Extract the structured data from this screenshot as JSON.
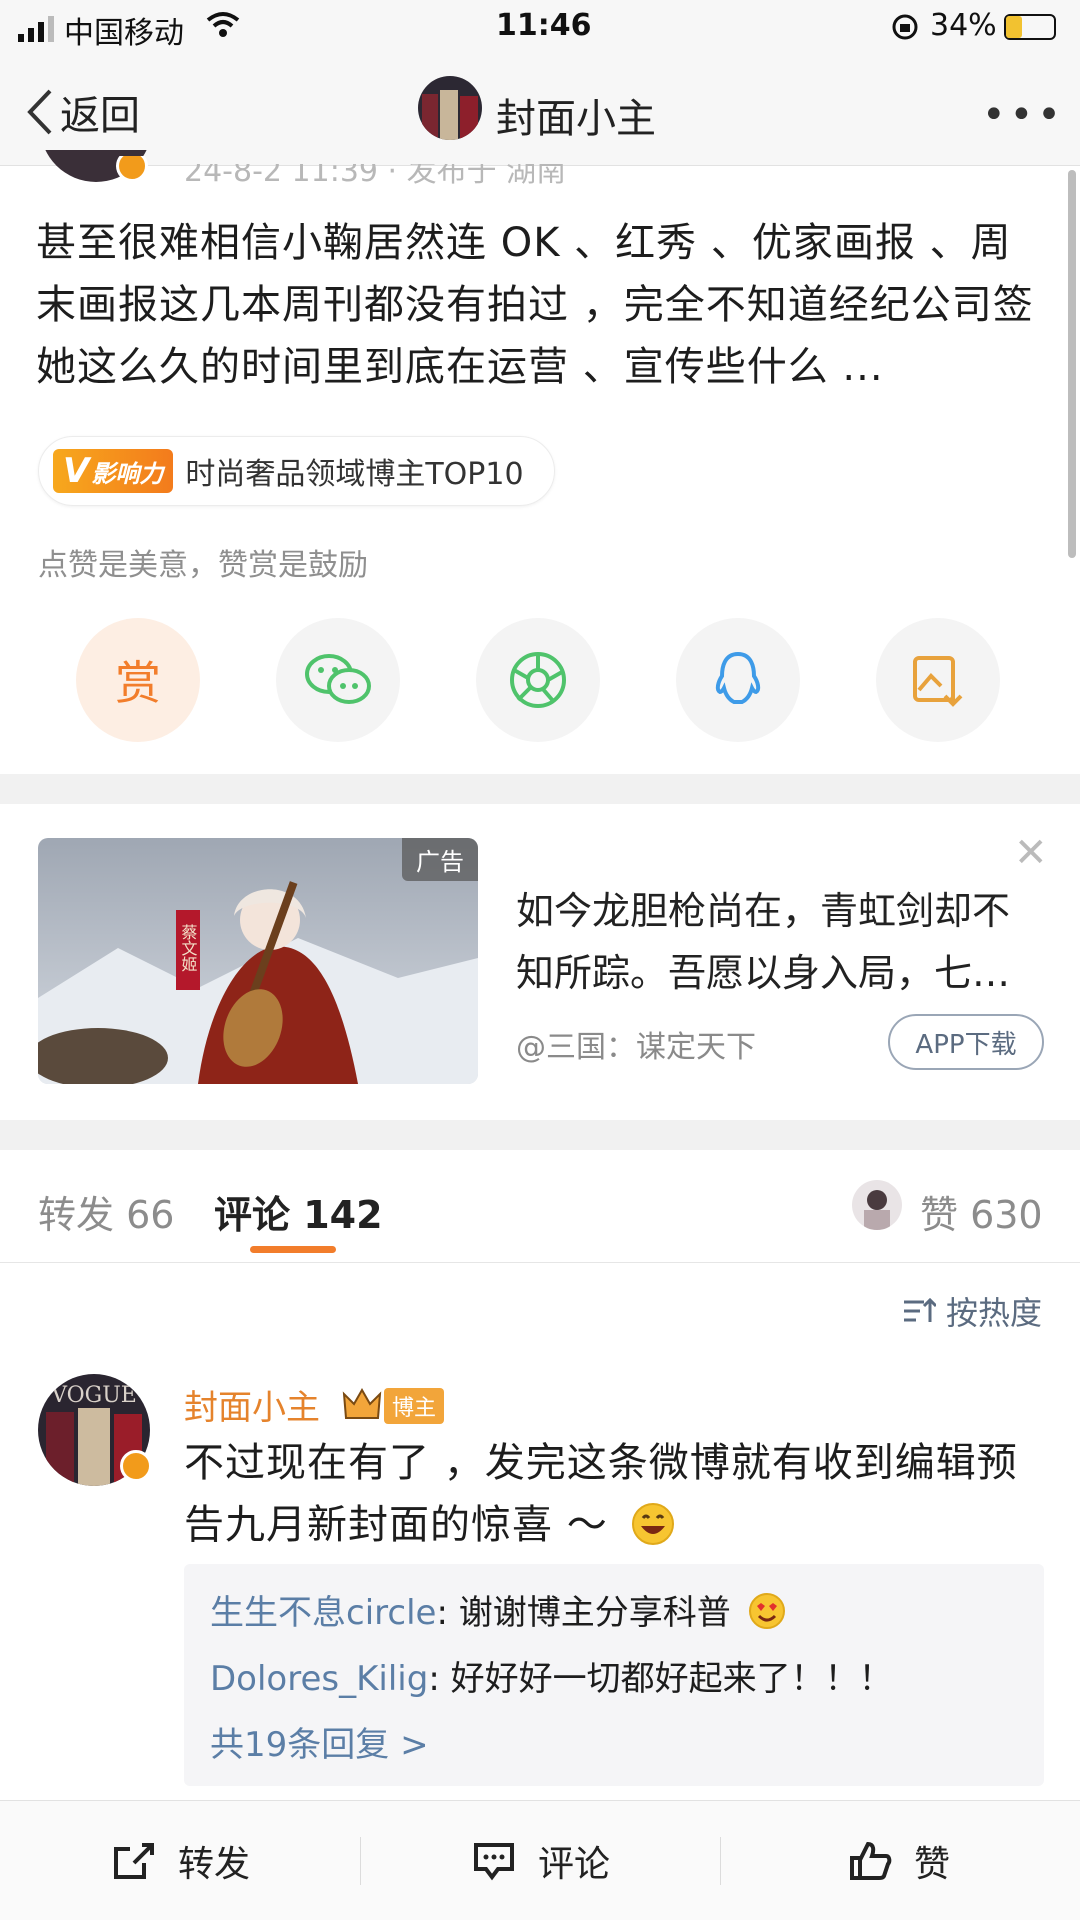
{
  "status_bar": {
    "carrier": "中国移动",
    "time": "11:46",
    "battery": "34%"
  },
  "header": {
    "back_label": "返回",
    "title": "封面小主",
    "more_label": "•••"
  },
  "post": {
    "meta_partial": "24-8-2 11:39 · 发布于 湖南",
    "body": "甚至很难相信小鞠居然连 OK 、红秀 、优家画报 、周末画报这几本周刊都没有拍过 ，完全不知道经纪公司签她这么久的时间里到底在运营 、宣传些什么 ...",
    "influence_badge": {
      "logo_text": "影响力",
      "label": "时尚奢品领域博主TOP10"
    },
    "reward_hint": "点赞是美意，赞赏是鼓励",
    "share_actions": {
      "reward_label": "赏",
      "icons": [
        "reward-icon",
        "wechat-icon",
        "moments-icon",
        "qq-icon",
        "save-image-icon"
      ]
    }
  },
  "ad": {
    "tag": "广告",
    "image_caption": "蔡文姬",
    "text": "如今龙胆枪尚在，青虹剑却不知所踪。吾愿以身入局，七…",
    "source": "@三国：谋定天下",
    "button_label": "APP下载",
    "close_label": "✕"
  },
  "tabs": {
    "repost": "转发 66",
    "comments": "评论 142",
    "likes": "赞 630"
  },
  "sort_label": "按热度",
  "comment": {
    "author": "封面小主",
    "author_tag": "博主",
    "text": "不过现在有了 ，发完这条微博就有收到编辑预告九月新封面的惊喜 ～",
    "replies": [
      {
        "user": "生生不息circle",
        "text": "谢谢博主分享科普"
      },
      {
        "user": "Dolores_Kilig",
        "text": "好好好一切都好起来了！！！"
      }
    ],
    "more_replies": "共19条回复 >"
  },
  "bottom_bar": {
    "repost": "转发",
    "comment": "评论",
    "like": "赞"
  },
  "colors": {
    "accent_orange": "#f27d2b",
    "link_blue": "#5b7ea6",
    "wechat_green": "#4fc36b",
    "qq_blue": "#3e9be8",
    "save_gold": "#e8a23c"
  }
}
